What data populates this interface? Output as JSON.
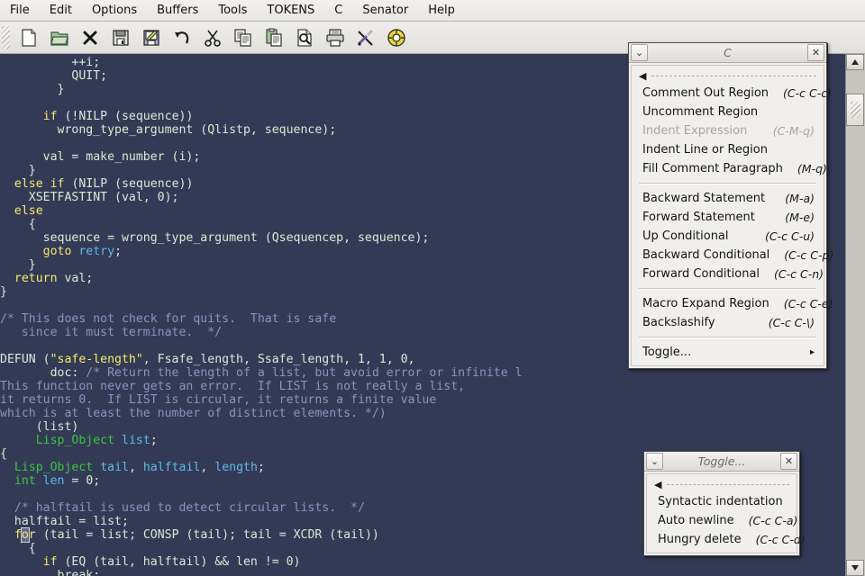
{
  "menubar": {
    "items": [
      {
        "label": "File",
        "name": "menu-file"
      },
      {
        "label": "Edit",
        "name": "menu-edit"
      },
      {
        "label": "Options",
        "name": "menu-options"
      },
      {
        "label": "Buffers",
        "name": "menu-buffers"
      },
      {
        "label": "Tools",
        "name": "menu-tools"
      },
      {
        "label": "TOKENS",
        "name": "menu-tokens"
      },
      {
        "label": "C",
        "name": "menu-c"
      },
      {
        "label": "Senator",
        "name": "menu-senator"
      },
      {
        "label": "Help",
        "name": "menu-help"
      }
    ]
  },
  "toolbar": {
    "buttons": [
      {
        "icon": "new-file-icon",
        "title": "New File"
      },
      {
        "icon": "open-folder-icon",
        "title": "Open File"
      },
      {
        "icon": "close-icon",
        "title": "Close"
      },
      {
        "icon": "save-icon",
        "title": "Save"
      },
      {
        "icon": "save-as-icon",
        "title": "Save As"
      },
      {
        "icon": "undo-icon",
        "title": "Undo"
      },
      {
        "icon": "cut-scissors-icon",
        "title": "Cut"
      },
      {
        "icon": "copy-icon",
        "title": "Copy"
      },
      {
        "icon": "paste-icon",
        "title": "Paste"
      },
      {
        "icon": "search-icon",
        "title": "Search"
      },
      {
        "icon": "print-icon",
        "title": "Print"
      },
      {
        "icon": "customize-tools-icon",
        "title": "Customize"
      },
      {
        "icon": "help-lifebuoy-icon",
        "title": "Help"
      }
    ]
  },
  "editor": {
    "background_color": "#323a56",
    "cursor_line_text": "for",
    "cursor_char": "o",
    "lines": [
      [
        {
          "t": "          ++i;",
          "c": "pl"
        }
      ],
      [
        {
          "t": "          QUIT;",
          "c": "pl"
        }
      ],
      [
        {
          "t": "        }",
          "c": "pl"
        }
      ],
      [
        {
          "t": "",
          "c": "pl"
        }
      ],
      [
        {
          "t": "      ",
          "c": "pl"
        },
        {
          "t": "if",
          "c": "k"
        },
        {
          "t": " (!NILP (sequence))",
          "c": "pl"
        }
      ],
      [
        {
          "t": "        wrong_type_argument (Qlistp, sequence);",
          "c": "pl"
        }
      ],
      [
        {
          "t": "",
          "c": "pl"
        }
      ],
      [
        {
          "t": "      val = make_number (i);",
          "c": "pl"
        }
      ],
      [
        {
          "t": "    }",
          "c": "pl"
        }
      ],
      [
        {
          "t": "  ",
          "c": "pl"
        },
        {
          "t": "else",
          "c": "k"
        },
        {
          "t": " ",
          "c": "pl"
        },
        {
          "t": "if",
          "c": "k"
        },
        {
          "t": " (NILP (sequence))",
          "c": "pl"
        }
      ],
      [
        {
          "t": "    XSETFASTINT (val, 0);",
          "c": "pl"
        }
      ],
      [
        {
          "t": "  ",
          "c": "pl"
        },
        {
          "t": "else",
          "c": "k"
        }
      ],
      [
        {
          "t": "    {",
          "c": "pl"
        }
      ],
      [
        {
          "t": "      sequence = wrong_type_argument (Qsequencep, sequence);",
          "c": "pl"
        }
      ],
      [
        {
          "t": "      ",
          "c": "pl"
        },
        {
          "t": "goto",
          "c": "k"
        },
        {
          "t": " ",
          "c": "pl"
        },
        {
          "t": "retry",
          "c": "va"
        },
        {
          "t": ";",
          "c": "pl"
        }
      ],
      [
        {
          "t": "    }",
          "c": "pl"
        }
      ],
      [
        {
          "t": "  ",
          "c": "pl"
        },
        {
          "t": "return",
          "c": "k"
        },
        {
          "t": " val;",
          "c": "pl"
        }
      ],
      [
        {
          "t": "}",
          "c": "pl"
        }
      ],
      [
        {
          "t": "",
          "c": "pl"
        }
      ],
      [
        {
          "t": "/* This does not check for quits.  That is safe",
          "c": "cm"
        }
      ],
      [
        {
          "t": "   since it must terminate.  */",
          "c": "cm"
        }
      ],
      [
        {
          "t": "",
          "c": "pl"
        }
      ],
      [
        {
          "t": "DEFUN (",
          "c": "pl"
        },
        {
          "t": "\"safe-length\"",
          "c": "st"
        },
        {
          "t": ", Fsafe_length, Ssafe_length, 1, 1, 0,",
          "c": "pl"
        }
      ],
      [
        {
          "t": "       doc: ",
          "c": "pl"
        },
        {
          "t": "/* Return the length of a list, but avoid error or infinite l",
          "c": "cm"
        }
      ],
      [
        {
          "t": "This function never gets an error.  If LIST is not really a list,",
          "c": "cm"
        }
      ],
      [
        {
          "t": "it returns 0.  If LIST is circular, it returns a finite value",
          "c": "cm"
        }
      ],
      [
        {
          "t": "which is at least the number of distinct elements. */)",
          "c": "cm"
        }
      ],
      [
        {
          "t": "     (list)",
          "c": "pl"
        }
      ],
      [
        {
          "t": "     ",
          "c": "pl"
        },
        {
          "t": "Lisp_Object",
          "c": "ty"
        },
        {
          "t": " ",
          "c": "pl"
        },
        {
          "t": "list",
          "c": "va"
        },
        {
          "t": ";",
          "c": "pl"
        }
      ],
      [
        {
          "t": "{",
          "c": "pl"
        }
      ],
      [
        {
          "t": "  ",
          "c": "pl"
        },
        {
          "t": "Lisp_Object",
          "c": "ty"
        },
        {
          "t": " ",
          "c": "pl"
        },
        {
          "t": "tail",
          "c": "va"
        },
        {
          "t": ", ",
          "c": "pl"
        },
        {
          "t": "halftail",
          "c": "va"
        },
        {
          "t": ", ",
          "c": "pl"
        },
        {
          "t": "length",
          "c": "va"
        },
        {
          "t": ";",
          "c": "pl"
        }
      ],
      [
        {
          "t": "  ",
          "c": "pl"
        },
        {
          "t": "int",
          "c": "ty"
        },
        {
          "t": " ",
          "c": "pl"
        },
        {
          "t": "len",
          "c": "va"
        },
        {
          "t": " = 0;",
          "c": "pl"
        }
      ],
      [
        {
          "t": "",
          "c": "pl"
        }
      ],
      [
        {
          "t": "  /* halftail is used to detect circular lists.  */",
          "c": "cm"
        }
      ],
      [
        {
          "t": "  halftail = list;",
          "c": "pl"
        }
      ],
      [
        {
          "t": "  ",
          "c": "pl"
        },
        {
          "t": "f",
          "c": "k"
        },
        {
          "t": "o",
          "c": "boxcur"
        },
        {
          "t": "r",
          "c": "k"
        },
        {
          "t": " (tail = list; CONSP (tail); tail = XCDR (tail))",
          "c": "pl"
        }
      ],
      [
        {
          "t": "    {",
          "c": "pl"
        }
      ],
      [
        {
          "t": "      ",
          "c": "pl"
        },
        {
          "t": "if",
          "c": "k"
        },
        {
          "t": " (EQ (tail, halftail) && len != 0)",
          "c": "pl"
        }
      ],
      [
        {
          "t": "        break;",
          "c": "pl"
        }
      ]
    ]
  },
  "scrollbar": {
    "up_arrow": "scroll-up-arrow",
    "down_arrow": "scroll-down-arrow"
  },
  "popup_c": {
    "title": "C",
    "collapse_label": "⌄",
    "close_label": "✕",
    "tearoff_arrow": "◀",
    "items": [
      {
        "label": "Comment Out Region",
        "key": "(C-c C-c)",
        "disabled": false,
        "submenu": false
      },
      {
        "label": "Uncomment Region",
        "key": "",
        "disabled": false,
        "submenu": false
      },
      {
        "label": "Indent Expression",
        "key": "(C-M-q)",
        "disabled": true,
        "submenu": false
      },
      {
        "label": "Indent Line or Region",
        "key": "",
        "disabled": false,
        "submenu": false
      },
      {
        "label": "Fill Comment Paragraph",
        "key": "(M-q)",
        "disabled": false,
        "submenu": false
      },
      {
        "separator": true
      },
      {
        "label": "Backward Statement",
        "key": "(M-a)",
        "disabled": false,
        "submenu": false
      },
      {
        "label": "Forward Statement",
        "key": "(M-e)",
        "disabled": false,
        "submenu": false
      },
      {
        "label": "Up Conditional",
        "key": "(C-c C-u)",
        "disabled": false,
        "submenu": false
      },
      {
        "label": "Backward Conditional",
        "key": "(C-c C-p)",
        "disabled": false,
        "submenu": false
      },
      {
        "label": "Forward Conditional",
        "key": "(C-c C-n)",
        "disabled": false,
        "submenu": false
      },
      {
        "separator": true
      },
      {
        "label": "Macro Expand Region",
        "key": "(C-c C-e)",
        "disabled": false,
        "submenu": false
      },
      {
        "label": "Backslashify",
        "key": "(C-c C-\\)",
        "disabled": false,
        "submenu": false
      },
      {
        "separator": true
      },
      {
        "label": "Toggle...",
        "key": "▸",
        "disabled": false,
        "submenu": true
      }
    ]
  },
  "popup_toggle": {
    "title": "Toggle...",
    "collapse_label": "⌄",
    "close_label": "✕",
    "tearoff_arrow": "◀",
    "items": [
      {
        "label": "Syntactic indentation",
        "key": "",
        "disabled": false
      },
      {
        "label": "Auto newline",
        "key": "(C-c C-a)",
        "disabled": false
      },
      {
        "label": "Hungry delete",
        "key": "(C-c C-d)",
        "disabled": false
      }
    ]
  }
}
